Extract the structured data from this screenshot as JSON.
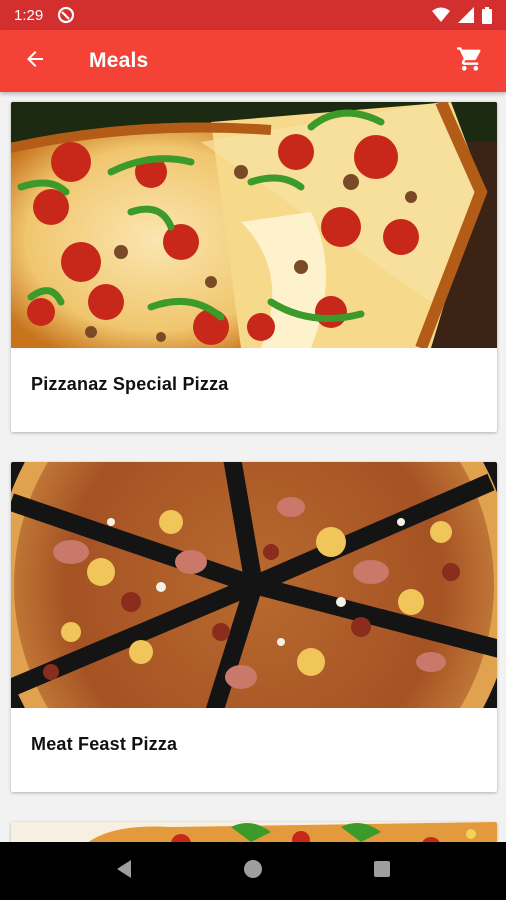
{
  "status_bar": {
    "time": "1:29"
  },
  "app_bar": {
    "title": "Meals"
  },
  "meals": [
    {
      "name": "Pizzanaz Special Pizza"
    },
    {
      "name": "Meat Feast Pizza"
    }
  ],
  "colors": {
    "status_bar": "#d32f2f",
    "app_bar": "#f44336"
  },
  "icons": {
    "back": "arrow-back-icon",
    "cart": "shopping-cart-icon",
    "nav_back": "triangle-back-icon",
    "nav_home": "circle-home-icon",
    "nav_recents": "square-recents-icon"
  }
}
